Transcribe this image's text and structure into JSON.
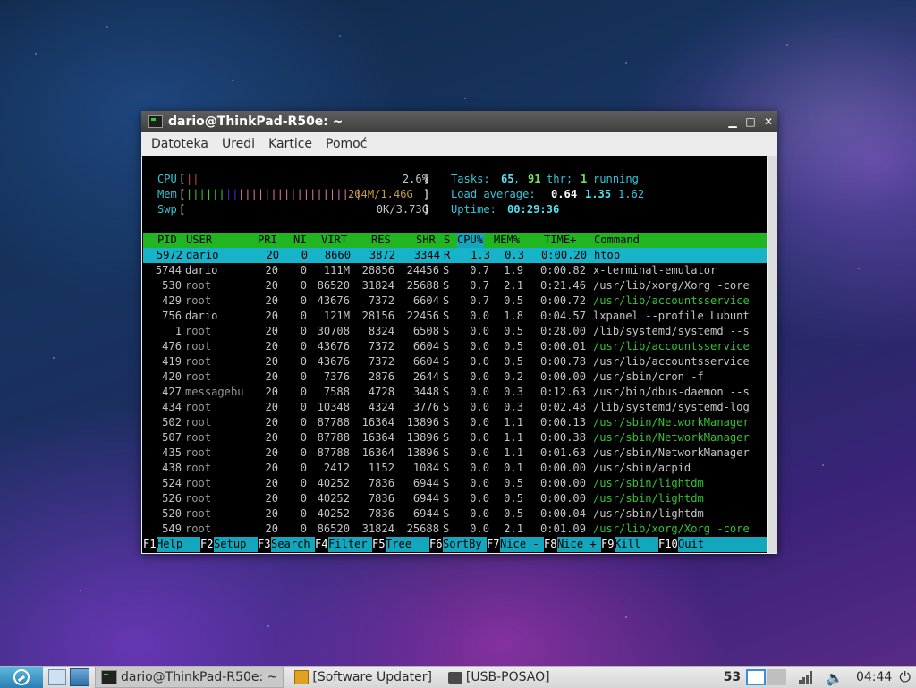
{
  "window": {
    "title": "dario@ThinkPad-R50e: ~"
  },
  "menu": [
    "Datoteka",
    "Uredi",
    "Kartice",
    "Pomoć"
  ],
  "meters": {
    "cpu_label": "CPU",
    "cpu_value": "2.6%",
    "mem_label": "Mem",
    "mem_value": "204M/1.46G",
    "swp_label": "Swp",
    "swp_value": "0K/3.73G"
  },
  "stats": {
    "tasks_label": "Tasks:",
    "tasks": "65",
    "threads": "91",
    "thr_label": "thr;",
    "running": "1",
    "running_label": "running",
    "load_label": "Load average:",
    "load1": "0.64",
    "load5": "1.35",
    "load15": "1.62",
    "uptime_label": "Uptime:",
    "uptime": "00:29:36"
  },
  "table": {
    "headers": {
      "pid": "PID",
      "user": "USER",
      "pri": "PRI",
      "ni": "NI",
      "virt": "VIRT",
      "res": "RES",
      "shr": "SHR",
      "s": "S",
      "cpu": "CPU%",
      "mem": "MEM%",
      "time": "TIME+",
      "cmd": "Command"
    },
    "rows": [
      {
        "pid": "5972",
        "user": "dario",
        "pri": "20",
        "ni": "0",
        "virt": "8660",
        "res": "3872",
        "shr": "3344",
        "s": "R",
        "cpu": "1.3",
        "mem": "0.3",
        "time": "0:00.20",
        "cmd": "htop",
        "selected": true
      },
      {
        "pid": "5744",
        "user": "dario",
        "pri": "20",
        "ni": "0",
        "virt": "111M",
        "res": "28856",
        "shr": "24456",
        "s": "S",
        "cpu": "0.7",
        "mem": "1.9",
        "time": "0:00.82",
        "cmd": "x-terminal-emulator"
      },
      {
        "pid": "530",
        "user": "root",
        "pri": "20",
        "ni": "0",
        "virt": "86520",
        "res": "31824",
        "shr": "25688",
        "s": "S",
        "cpu": "0.7",
        "mem": "2.1",
        "time": "0:21.46",
        "cmd": "/usr/lib/xorg/Xorg -core"
      },
      {
        "pid": "429",
        "user": "root",
        "pri": "20",
        "ni": "0",
        "virt": "43676",
        "res": "7372",
        "shr": "6604",
        "s": "S",
        "cpu": "0.7",
        "mem": "0.5",
        "time": "0:00.72",
        "cmd": "/usr/lib/accountsservice",
        "thread": true
      },
      {
        "pid": "756",
        "user": "dario",
        "pri": "20",
        "ni": "0",
        "virt": "121M",
        "res": "28156",
        "shr": "22456",
        "s": "S",
        "cpu": "0.0",
        "mem": "1.8",
        "time": "0:04.57",
        "cmd": "lxpanel --profile Lubunt"
      },
      {
        "pid": "1",
        "user": "root",
        "pri": "20",
        "ni": "0",
        "virt": "30708",
        "res": "8324",
        "shr": "6508",
        "s": "S",
        "cpu": "0.0",
        "mem": "0.5",
        "time": "0:28.00",
        "cmd": "/lib/systemd/systemd --s"
      },
      {
        "pid": "476",
        "user": "root",
        "pri": "20",
        "ni": "0",
        "virt": "43676",
        "res": "7372",
        "shr": "6604",
        "s": "S",
        "cpu": "0.0",
        "mem": "0.5",
        "time": "0:00.01",
        "cmd": "/usr/lib/accountsservice",
        "thread": true
      },
      {
        "pid": "419",
        "user": "root",
        "pri": "20",
        "ni": "0",
        "virt": "43676",
        "res": "7372",
        "shr": "6604",
        "s": "S",
        "cpu": "0.0",
        "mem": "0.5",
        "time": "0:00.78",
        "cmd": "/usr/lib/accountsservice"
      },
      {
        "pid": "420",
        "user": "root",
        "pri": "20",
        "ni": "0",
        "virt": "7376",
        "res": "2876",
        "shr": "2644",
        "s": "S",
        "cpu": "0.0",
        "mem": "0.2",
        "time": "0:00.00",
        "cmd": "/usr/sbin/cron -f"
      },
      {
        "pid": "427",
        "user": "messagebu",
        "pri": "20",
        "ni": "0",
        "virt": "7588",
        "res": "4728",
        "shr": "3448",
        "s": "S",
        "cpu": "0.0",
        "mem": "0.3",
        "time": "0:12.63",
        "cmd": "/usr/bin/dbus-daemon --s"
      },
      {
        "pid": "434",
        "user": "root",
        "pri": "20",
        "ni": "0",
        "virt": "10348",
        "res": "4324",
        "shr": "3776",
        "s": "S",
        "cpu": "0.0",
        "mem": "0.3",
        "time": "0:02.48",
        "cmd": "/lib/systemd/systemd-log"
      },
      {
        "pid": "502",
        "user": "root",
        "pri": "20",
        "ni": "0",
        "virt": "87788",
        "res": "16364",
        "shr": "13896",
        "s": "S",
        "cpu": "0.0",
        "mem": "1.1",
        "time": "0:00.13",
        "cmd": "/usr/sbin/NetworkManager",
        "thread": true
      },
      {
        "pid": "507",
        "user": "root",
        "pri": "20",
        "ni": "0",
        "virt": "87788",
        "res": "16364",
        "shr": "13896",
        "s": "S",
        "cpu": "0.0",
        "mem": "1.1",
        "time": "0:00.38",
        "cmd": "/usr/sbin/NetworkManager",
        "thread": true
      },
      {
        "pid": "435",
        "user": "root",
        "pri": "20",
        "ni": "0",
        "virt": "87788",
        "res": "16364",
        "shr": "13896",
        "s": "S",
        "cpu": "0.0",
        "mem": "1.1",
        "time": "0:01.63",
        "cmd": "/usr/sbin/NetworkManager"
      },
      {
        "pid": "438",
        "user": "root",
        "pri": "20",
        "ni": "0",
        "virt": "2412",
        "res": "1152",
        "shr": "1084",
        "s": "S",
        "cpu": "0.0",
        "mem": "0.1",
        "time": "0:00.00",
        "cmd": "/usr/sbin/acpid"
      },
      {
        "pid": "524",
        "user": "root",
        "pri": "20",
        "ni": "0",
        "virt": "40252",
        "res": "7836",
        "shr": "6944",
        "s": "S",
        "cpu": "0.0",
        "mem": "0.5",
        "time": "0:00.00",
        "cmd": "/usr/sbin/lightdm",
        "thread": true
      },
      {
        "pid": "526",
        "user": "root",
        "pri": "20",
        "ni": "0",
        "virt": "40252",
        "res": "7836",
        "shr": "6944",
        "s": "S",
        "cpu": "0.0",
        "mem": "0.5",
        "time": "0:00.00",
        "cmd": "/usr/sbin/lightdm",
        "thread": true
      },
      {
        "pid": "520",
        "user": "root",
        "pri": "20",
        "ni": "0",
        "virt": "40252",
        "res": "7836",
        "shr": "6944",
        "s": "S",
        "cpu": "0.0",
        "mem": "0.5",
        "time": "0:00.04",
        "cmd": "/usr/sbin/lightdm"
      },
      {
        "pid": "549",
        "user": "root",
        "pri": "20",
        "ni": "0",
        "virt": "86520",
        "res": "31824",
        "shr": "25688",
        "s": "S",
        "cpu": "0.0",
        "mem": "2.1",
        "time": "0:01.09",
        "cmd": "/usr/lib/xorg/Xorg -core",
        "thread": true
      }
    ]
  },
  "fkeys": [
    {
      "key": "F1",
      "label": "Help"
    },
    {
      "key": "F2",
      "label": "Setup"
    },
    {
      "key": "F3",
      "label": "Search"
    },
    {
      "key": "F4",
      "label": "Filter"
    },
    {
      "key": "F5",
      "label": "Tree"
    },
    {
      "key": "F6",
      "label": "SortBy"
    },
    {
      "key": "F7",
      "label": "Nice -"
    },
    {
      "key": "F8",
      "label": "Nice +"
    },
    {
      "key": "F9",
      "label": "Kill"
    },
    {
      "key": "F10",
      "label": "Quit"
    }
  ],
  "taskbar": {
    "tasks": [
      "dario@ThinkPad-R50e: ~",
      "[Software Updater]",
      "[USB-POSAO]"
    ],
    "tray_number": "53",
    "clock": "04:44"
  },
  "colors": {
    "header_bg": "#21b621",
    "selected_bg": "#16b3c9",
    "thread_text": "#33c333"
  }
}
